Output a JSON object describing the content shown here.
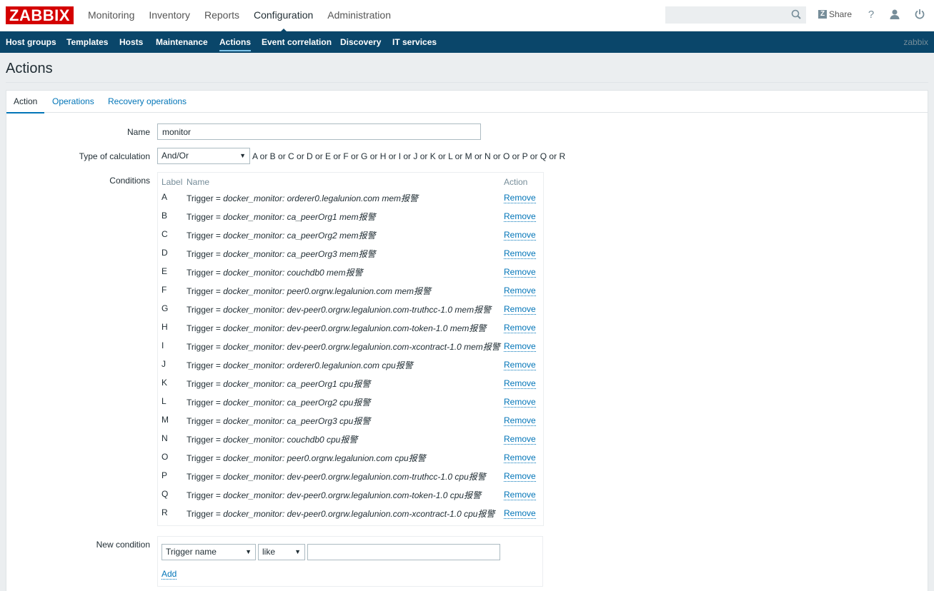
{
  "header": {
    "logo": "ZABBIX",
    "nav": [
      "Monitoring",
      "Inventory",
      "Reports",
      "Configuration",
      "Administration"
    ],
    "selected_nav": "Configuration",
    "search_value": "",
    "share_label": "Share",
    "help_label": "?"
  },
  "subnav": {
    "items": [
      "Host groups",
      "Templates",
      "Hosts",
      "Maintenance",
      "Actions",
      "Event correlation",
      "Discovery",
      "IT services"
    ],
    "selected": "Actions",
    "server_name": "zabbix"
  },
  "page_title": "Actions",
  "tabs": [
    "Action",
    "Operations",
    "Recovery operations"
  ],
  "form": {
    "name_label": "Name",
    "name_value": "monitor",
    "calc_label": "Type of calculation",
    "calc_value": "And/Or",
    "calc_formula": "A or B or C or D or E or F or G or H or I or J or K or L or M or N or O or P or Q or R",
    "conditions_label": "Conditions",
    "conditions_headers": {
      "label": "Label",
      "name": "Name",
      "action": "Action"
    },
    "remove_label": "Remove",
    "conditions": [
      {
        "label": "A",
        "prefix": "Trigger = ",
        "value": "docker_monitor: orderer0.legalunion.com mem报警"
      },
      {
        "label": "B",
        "prefix": "Trigger = ",
        "value": "docker_monitor: ca_peerOrg1 mem报警"
      },
      {
        "label": "C",
        "prefix": "Trigger = ",
        "value": "docker_monitor: ca_peerOrg2 mem报警"
      },
      {
        "label": "D",
        "prefix": "Trigger = ",
        "value": "docker_monitor: ca_peerOrg3 mem报警"
      },
      {
        "label": "E",
        "prefix": "Trigger = ",
        "value": "docker_monitor: couchdb0 mem报警"
      },
      {
        "label": "F",
        "prefix": "Trigger = ",
        "value": "docker_monitor: peer0.orgrw.legalunion.com mem报警"
      },
      {
        "label": "G",
        "prefix": "Trigger = ",
        "value": "docker_monitor: dev-peer0.orgrw.legalunion.com-truthcc-1.0 mem报警"
      },
      {
        "label": "H",
        "prefix": "Trigger = ",
        "value": "docker_monitor: dev-peer0.orgrw.legalunion.com-token-1.0 mem报警"
      },
      {
        "label": "I",
        "prefix": "Trigger = ",
        "value": "docker_monitor: dev-peer0.orgrw.legalunion.com-xcontract-1.0 mem报警"
      },
      {
        "label": "J",
        "prefix": "Trigger = ",
        "value": "docker_monitor: orderer0.legalunion.com cpu报警"
      },
      {
        "label": "K",
        "prefix": "Trigger = ",
        "value": "docker_monitor: ca_peerOrg1 cpu报警"
      },
      {
        "label": "L",
        "prefix": "Trigger = ",
        "value": "docker_monitor: ca_peerOrg2 cpu报警"
      },
      {
        "label": "M",
        "prefix": "Trigger = ",
        "value": "docker_monitor: ca_peerOrg3 cpu报警"
      },
      {
        "label": "N",
        "prefix": "Trigger = ",
        "value": "docker_monitor: couchdb0 cpu报警"
      },
      {
        "label": "O",
        "prefix": "Trigger = ",
        "value": "docker_monitor: peer0.orgrw.legalunion.com cpu报警"
      },
      {
        "label": "P",
        "prefix": "Trigger = ",
        "value": "docker_monitor: dev-peer0.orgrw.legalunion.com-truthcc-1.0 cpu报警"
      },
      {
        "label": "Q",
        "prefix": "Trigger = ",
        "value": "docker_monitor: dev-peer0.orgrw.legalunion.com-token-1.0 cpu报警"
      },
      {
        "label": "R",
        "prefix": "Trigger = ",
        "value": "docker_monitor: dev-peer0.orgrw.legalunion.com-xcontract-1.0 cpu报警"
      }
    ],
    "new_condition_label": "New condition",
    "new_condition_type": "Trigger name",
    "new_condition_operator": "like",
    "new_condition_value": "",
    "add_label": "Add"
  },
  "colors": {
    "logo_red": "#d40000",
    "subnav_bg": "#0a466a",
    "link_blue": "#0275b8"
  }
}
